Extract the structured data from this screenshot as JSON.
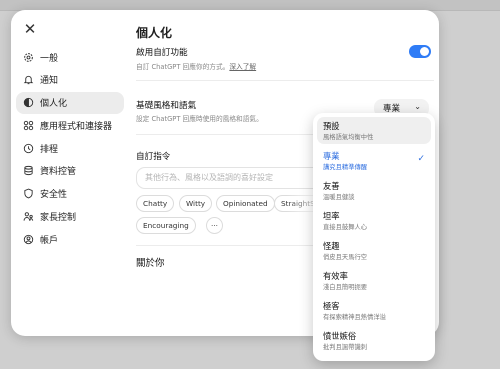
{
  "sidebar": {
    "close_label": "✕",
    "items": [
      {
        "label": "一般",
        "icon": "gear-icon"
      },
      {
        "label": "通知",
        "icon": "bell-icon"
      },
      {
        "label": "個人化",
        "icon": "personalization-icon",
        "active": true
      },
      {
        "label": "應用程式和連接器",
        "icon": "apps-grid-icon"
      },
      {
        "label": "排程",
        "icon": "clock-icon"
      },
      {
        "label": "資料控管",
        "icon": "database-icon"
      },
      {
        "label": "安全性",
        "icon": "shield-icon"
      },
      {
        "label": "家長控制",
        "icon": "family-icon"
      },
      {
        "label": "帳戶",
        "icon": "account-icon"
      }
    ]
  },
  "main": {
    "title": "個人化",
    "custom_features": {
      "title": "啟用自訂功能",
      "subtitle": "自訂 ChatGPT 回應你的方式。",
      "link": "深入了解",
      "enabled": true
    },
    "base_style": {
      "title": "基礎風格和語氣",
      "subtitle": "設定 ChatGPT 回應時使用的風格和語氣。",
      "value": "專業"
    },
    "custom_instructions": {
      "title": "自訂指令",
      "placeholder": "其他行為、風格以及語調的喜好設定",
      "chips": [
        "Chatty",
        "Witty",
        "Opinionated",
        "StraightSh",
        "Encouraging",
        "···"
      ]
    },
    "about_you": {
      "title": "關於你"
    }
  },
  "dropdown": {
    "options": [
      {
        "label": "預設",
        "desc": "風格語氣均衡中性",
        "highlighted": true
      },
      {
        "label": "專業",
        "desc": "講究且精準傳醒",
        "selected": true
      },
      {
        "label": "友善",
        "desc": "溫暖且健談"
      },
      {
        "label": "坦率",
        "desc": "直接且鼓舞人心"
      },
      {
        "label": "怪趣",
        "desc": "俏皮且天馬行空"
      },
      {
        "label": "有效率",
        "desc": "淺白且簡明扼要"
      },
      {
        "label": "極客",
        "desc": "有探索精神且熱情洋溢"
      },
      {
        "label": "憤世嫉俗",
        "desc": "批判且諷帶譏刺"
      }
    ],
    "check_glyph": "✓"
  },
  "colors": {
    "accent": "#2f7cf6",
    "selected_text": "#2f6fe0"
  }
}
